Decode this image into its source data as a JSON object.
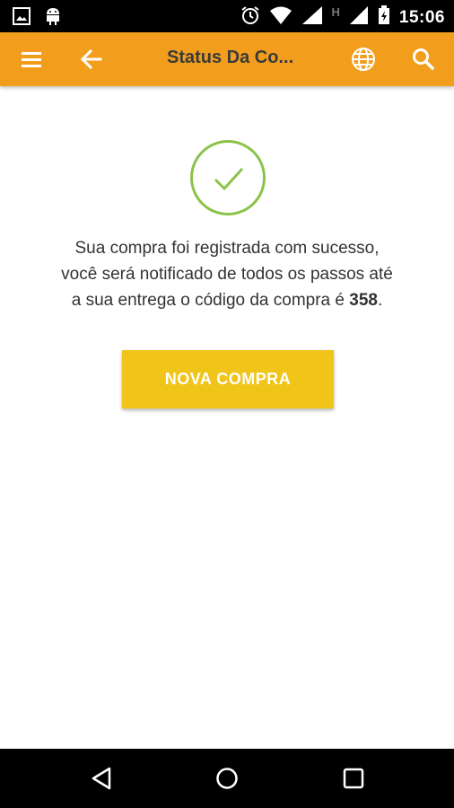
{
  "status_bar": {
    "time": "15:06",
    "network_label": "H"
  },
  "app_bar": {
    "title": "Status Da Co..."
  },
  "success": {
    "message_line1": "Sua compra foi registrada com sucesso,",
    "message_line2": "você será notificado de todos os passos até",
    "message_line3_prefix": "a sua entrega o código da compra é ",
    "purchase_code": "358",
    "message_line3_suffix": "."
  },
  "actions": {
    "new_purchase_label": "NOVA COMPRA"
  },
  "colors": {
    "app_bar": "#f29e1c",
    "button": "#f0c419",
    "check": "#8bc34a"
  },
  "icons": [
    "image-icon",
    "android-icon",
    "alarm-icon",
    "wifi-icon",
    "signal-icon",
    "battery-icon",
    "menu-icon",
    "back-arrow-icon",
    "globe-icon",
    "search-icon",
    "check-icon",
    "nav-back-icon",
    "nav-home-icon",
    "nav-recents-icon"
  ]
}
